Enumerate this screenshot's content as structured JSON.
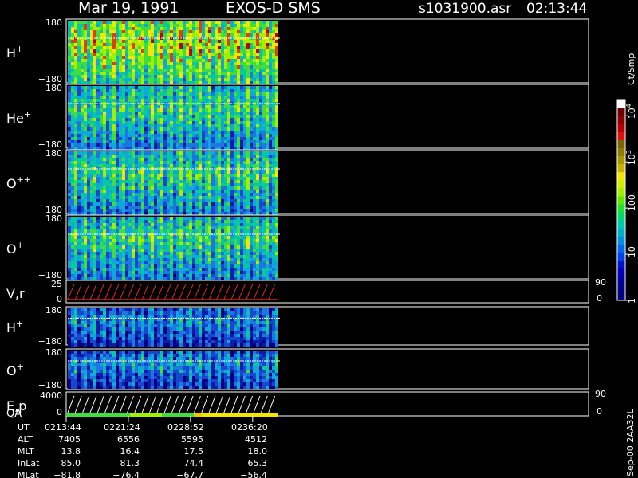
{
  "header": {
    "date": "Mar 19, 1991",
    "instrument": "EXOS-D SMS",
    "file": "s1031900.asr",
    "time": "02:13:44"
  },
  "panels": [
    {
      "id": "h-plus-1",
      "species": "H",
      "sup": "+",
      "ymax": "180",
      "ymin": "−180"
    },
    {
      "id": "he-plus",
      "species": "He",
      "sup": "+",
      "ymax": "180",
      "ymin": "−180"
    },
    {
      "id": "o-plus-plus",
      "species": "O",
      "sup": "++",
      "ymax": "180",
      "ymin": "−180"
    },
    {
      "id": "o-plus-1",
      "species": "O",
      "sup": "+",
      "ymax": "180",
      "ymin": "−180"
    },
    {
      "id": "vr",
      "species": "V,r",
      "sup": "",
      "ymax": "25",
      "ymin": "0",
      "rmax": "90",
      "rmin": "0"
    },
    {
      "id": "h-plus-2",
      "species": "H",
      "sup": "+",
      "ymax": "180",
      "ymin": "−180"
    },
    {
      "id": "o-plus-2",
      "species": "O",
      "sup": "+",
      "ymax": "180",
      "ymin": "−180"
    },
    {
      "id": "ep",
      "species": "E,p",
      "sup": "",
      "ymax": "4000",
      "ymin": "0",
      "rmax": "90",
      "rmin": "0"
    }
  ],
  "qa_label": "QA",
  "colorbar": {
    "unit": "Ct/Smp",
    "ticks": [
      {
        "label": "1",
        "value": 1,
        "base": "",
        "exp": ""
      },
      {
        "label": "10",
        "value": 10,
        "base": "",
        "exp": ""
      },
      {
        "label": "100",
        "value": 100,
        "base": "",
        "exp": ""
      },
      {
        "label": "",
        "value": 1000,
        "base": "10",
        "exp": "3"
      },
      {
        "label": "",
        "value": 10000,
        "base": "10",
        "exp": "4"
      }
    ],
    "colors": [
      "#000080",
      "#00008c",
      "#0000a0",
      "#0000b8",
      "#0014d0",
      "#0040e8",
      "#0068f0",
      "#0090e0",
      "#00b0c8",
      "#00c8b0",
      "#00d870",
      "#20e030",
      "#60e800",
      "#a0f000",
      "#d0f000",
      "#f0e800",
      "#c8b400",
      "#a89800",
      "#8c7c00",
      "#806400",
      "#e01010",
      "#b40000",
      "#8c0000",
      "#700000",
      "#ffffff"
    ]
  },
  "footer_id": "Sep-00  2AA32L",
  "ephemeris": {
    "labels": [
      "UT",
      "ALT",
      "MLT",
      "InLat",
      "MLat"
    ],
    "columns": [
      {
        "UT": "0213:44",
        "ALT": "7405",
        "MLT": "13.8",
        "InLat": "85.0",
        "MLat": "−81.8"
      },
      {
        "UT": "0221:24",
        "ALT": "6556",
        "MLT": "16.4",
        "InLat": "81.3",
        "MLat": "−76.4"
      },
      {
        "UT": "0228:52",
        "ALT": "5595",
        "MLT": "17.5",
        "InLat": "74.4",
        "MLat": "−67.7"
      },
      {
        "UT": "0236:20",
        "ALT": "4512",
        "MLT": "18.0",
        "InLat": "65.3",
        "MLat": "−56.4"
      }
    ]
  }
}
